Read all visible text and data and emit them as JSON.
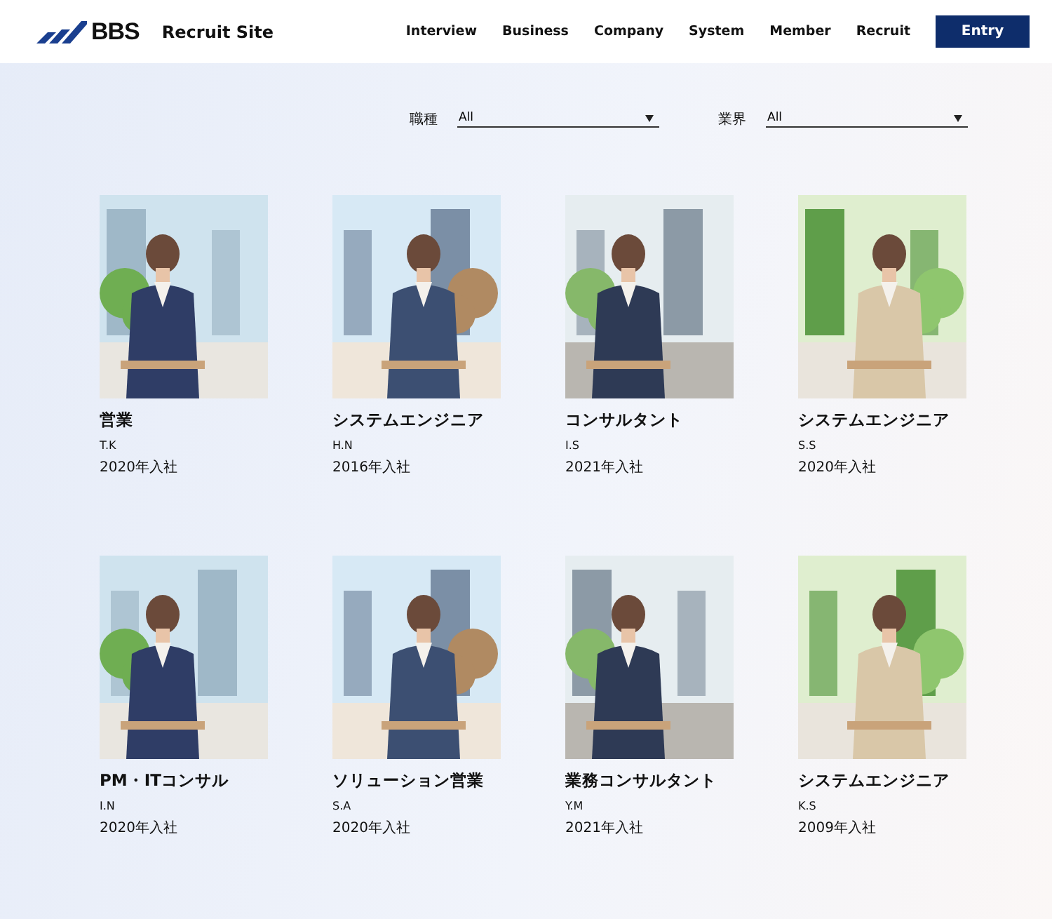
{
  "header": {
    "logo": "BBS",
    "site_title": "Recruit Site",
    "nav": [
      "Interview",
      "Business",
      "Company",
      "System",
      "Member",
      "Recruit"
    ],
    "entry_button": "Entry"
  },
  "filters": [
    {
      "label": "職種",
      "value": "All"
    },
    {
      "label": "業界",
      "value": "All"
    }
  ],
  "members": [
    {
      "role": "営業",
      "initials": "T.K",
      "joined": "2020年入社"
    },
    {
      "role": "システムエンジニア",
      "initials": "H.N",
      "joined": "2016年入社"
    },
    {
      "role": "コンサルタント",
      "initials": "I.S",
      "joined": "2021年入社"
    },
    {
      "role": "システムエンジニア",
      "initials": "S.S",
      "joined": "2020年入社"
    },
    {
      "role": "PM・ITコンサル",
      "initials": "I.N",
      "joined": "2020年入社"
    },
    {
      "role": "ソリューション営業",
      "initials": "S.A",
      "joined": "2020年入社"
    },
    {
      "role": "業務コンサルタント",
      "initials": "Y.M",
      "joined": "2021年入社"
    },
    {
      "role": "システムエンジニア",
      "initials": "K.S",
      "joined": "2009年入社"
    }
  ]
}
